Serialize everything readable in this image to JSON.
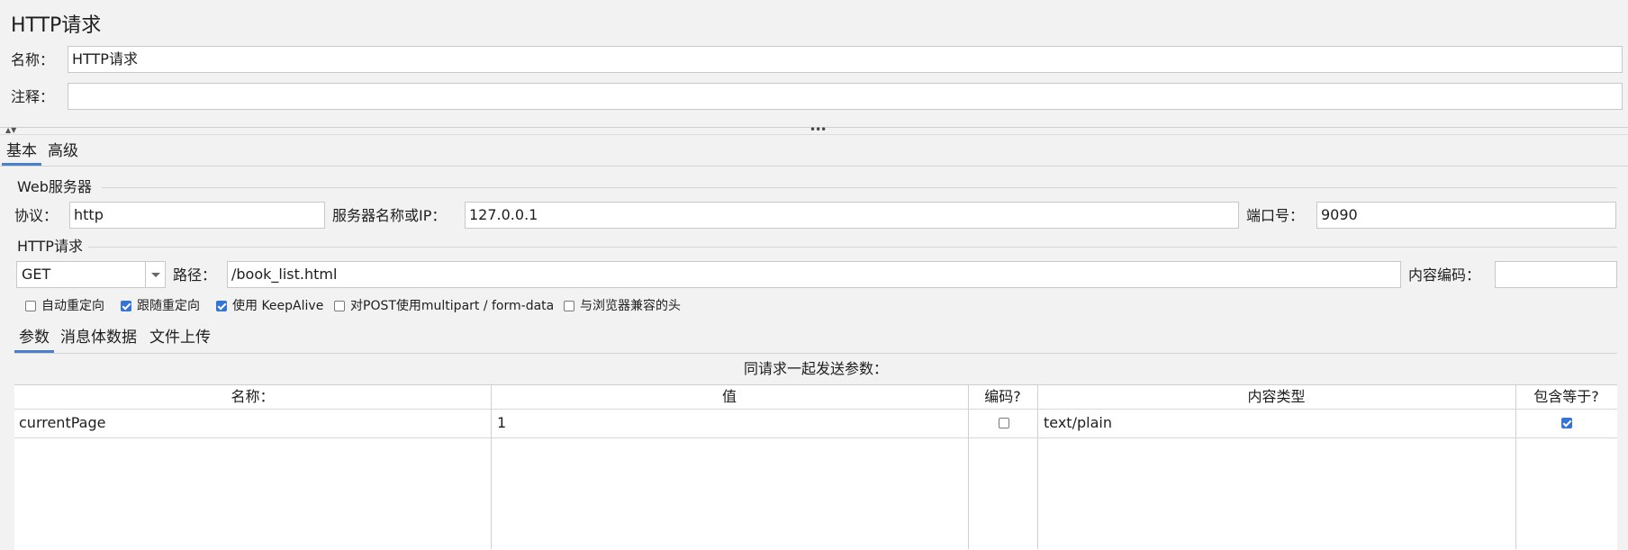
{
  "panel": {
    "title": "HTTP请求"
  },
  "name_label": "名称：",
  "name_value": "HTTP请求",
  "comment_label": "注释：",
  "comment_value": "",
  "tabs": {
    "basic": "基本",
    "advanced": "高级"
  },
  "web_server": {
    "section_title": "Web服务器",
    "protocol_label": "协议：",
    "protocol_value": "http",
    "server_label": "服务器名称或IP：",
    "server_value": "127.0.0.1",
    "port_label": "端口号：",
    "port_value": "9090"
  },
  "http_request": {
    "section_title": "HTTP请求",
    "method_value": "GET",
    "path_label": "路径：",
    "path_value": "/book_list.html",
    "encoding_label": "内容编码：",
    "encoding_value": ""
  },
  "options": [
    {
      "label": "自动重定向",
      "checked": false
    },
    {
      "label": "跟随重定向",
      "checked": true
    },
    {
      "label": "使用 KeepAlive",
      "checked": true
    },
    {
      "label": "对POST使用multipart / form-data",
      "checked": false
    },
    {
      "label": "与浏览器兼容的头",
      "checked": false
    }
  ],
  "subtabs": {
    "params": "参数",
    "body": "消息体数据",
    "files": "文件上传"
  },
  "params_caption": "同请求一起发送参数：",
  "table": {
    "headers": [
      "名称：",
      "值",
      "编码?",
      "内容类型",
      "包含等于?"
    ],
    "rows": [
      {
        "name": "currentPage",
        "value": "1",
        "encode": false,
        "content_type": "text/plain",
        "include_equals": true
      }
    ]
  }
}
